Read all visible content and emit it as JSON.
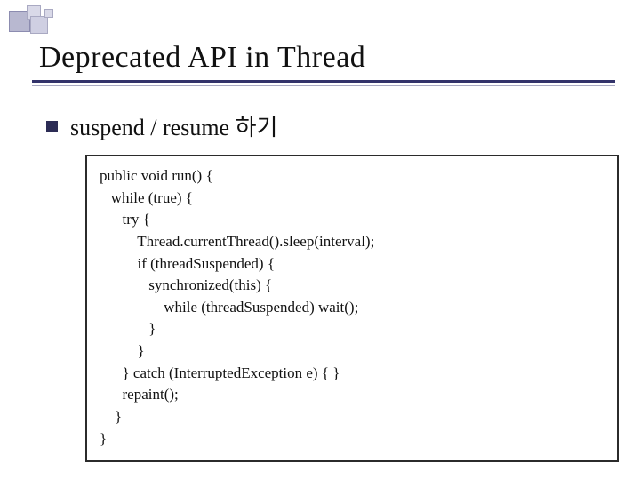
{
  "title": "Deprecated API in Thread",
  "bullet": {
    "text": "suspend / resume 하기"
  },
  "code": {
    "l1": "public void run() {",
    "l2": "   while (true) {",
    "l3": "      try {",
    "l4": "          Thread.currentThread().sleep(interval);",
    "l5": "          if (threadSuspended) {",
    "l6": "             synchronized(this) {",
    "l7": "                 while (threadSuspended) wait();",
    "l8": "             }",
    "l9": "          }",
    "l10": "      } catch (InterruptedException e) { }",
    "l11": "      repaint();",
    "l12": "    }",
    "l13": "}"
  }
}
